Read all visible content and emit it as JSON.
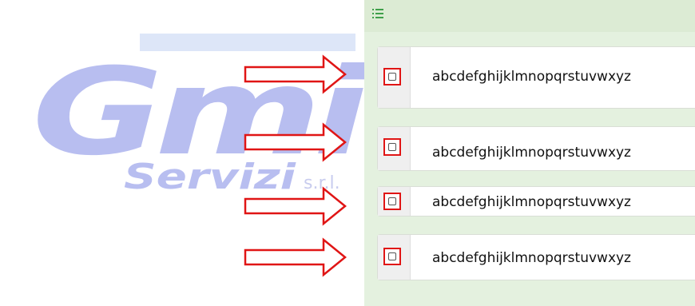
{
  "logo": {
    "main_text": "Gmi",
    "sub_text": "Servizi",
    "suffix_text": "s.r.l."
  },
  "panel": {
    "header_icon": "list-icon",
    "rows": [
      {
        "label": "abcdefghijklmnopqrstuvwxyz",
        "checked": false
      },
      {
        "label": "abcdefghijklmnopqrstuvwxyz",
        "checked": false
      },
      {
        "label": "abcdefghijklmnopqrstuvwxyz",
        "checked": false
      },
      {
        "label": "abcdefghijklmnopqrstuvwxyz",
        "checked": false
      }
    ]
  },
  "colors": {
    "panel_bg": "#e4f1df",
    "highlight": "#e01515",
    "logo": "#b8bef0"
  }
}
